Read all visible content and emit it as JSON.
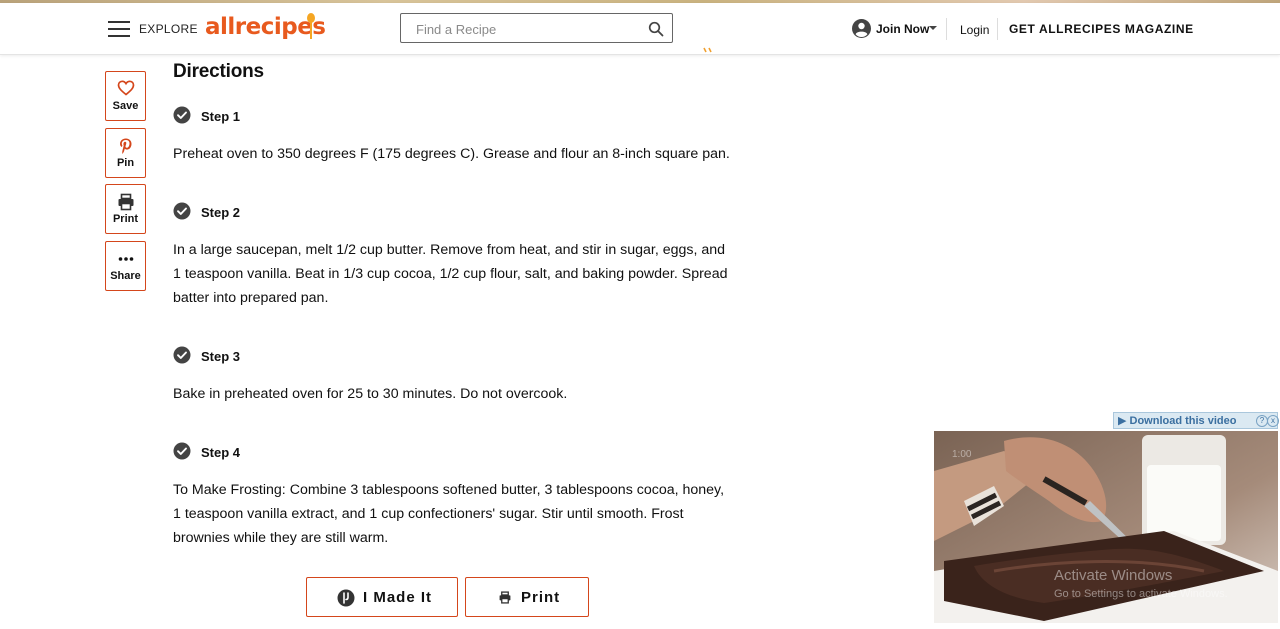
{
  "header": {
    "menu_label": "EXPLORE",
    "logo_text": "allrecipes",
    "search_placeholder": "Find a Recipe",
    "join_label": "Join Now",
    "login_label": "Login",
    "magazine_label": "GET ALLRECIPES MAGAZINE"
  },
  "side_actions": [
    {
      "label": "Save",
      "icon": "heart-icon"
    },
    {
      "label": "Pin",
      "icon": "pinterest-icon"
    },
    {
      "label": "Print",
      "icon": "printer-icon"
    },
    {
      "label": "Share",
      "icon": "more-dots-icon"
    }
  ],
  "directions": {
    "title": "Directions",
    "steps": [
      {
        "label": "Step 1",
        "text": "Preheat oven to 350 degrees F (175 degrees C). Grease and flour an 8-inch square pan."
      },
      {
        "label": "Step 2",
        "text": "In a large saucepan, melt 1/2 cup butter. Remove from heat, and stir in sugar, eggs, and 1 teaspoon vanilla. Beat in 1/3 cup cocoa, 1/2 cup flour, salt, and baking powder. Spread batter into prepared pan."
      },
      {
        "label": "Step 3",
        "text": "Bake in preheated oven for 25 to 30 minutes. Do not overcook."
      },
      {
        "label": "Step 4",
        "text": "To Make Frosting: Combine 3 tablespoons softened butter, 3 tablespoons cocoa, honey, 1 teaspoon vanilla extract, and 1 cup confectioners' sugar. Stir until smooth. Frost brownies while they are still warm."
      }
    ]
  },
  "buttons": {
    "made_it": "I Made It",
    "print": "Print"
  },
  "video": {
    "download_label": "Download this video",
    "help_glyph": "?",
    "close_glyph": "x",
    "timestamp": "1:00",
    "watermark_title": "Activate Windows",
    "watermark_sub": "Go to Settings to activate Windows."
  },
  "colors": {
    "accent": "#d4461b",
    "logo": "#e85a1e",
    "check": "#444444"
  }
}
